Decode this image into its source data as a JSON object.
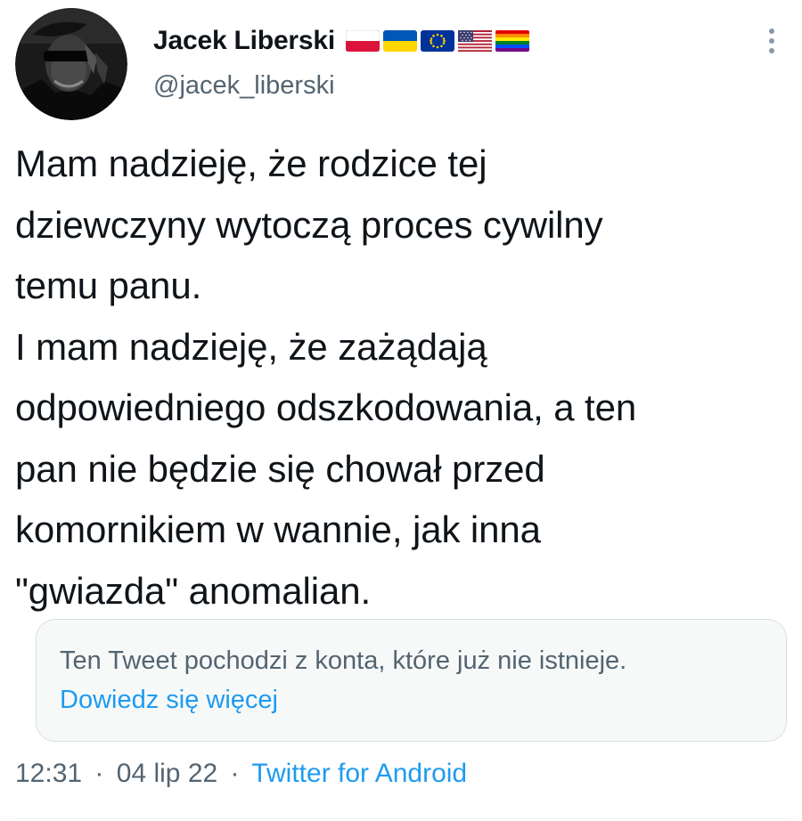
{
  "author": {
    "display_name": "Jacek Liberski",
    "handle": "@jacek_liberski",
    "flags": [
      "poland-flag-icon",
      "ukraine-flag-icon",
      "eu-flag-icon",
      "usa-flag-icon",
      "rainbow-flag-icon"
    ]
  },
  "tweet": {
    "text": "Mam nadzieję, że rodzice tej\ndziewczyny wytoczą proces cywilny\ntemu panu.\nI mam nadzieję, że zażądają\nodpowiedniego odszkodowania, a ten\npan nie będzie się chował przed\nkomornikiem w wannie, jak inna\n\"gwiazda\" anomalian."
  },
  "notice": {
    "text": "Ten Tweet pochodzi z konta, które już nie istnieje.",
    "link_label": "Dowiedz się więcej"
  },
  "meta": {
    "time": "12:31",
    "separator": "·",
    "date": "04 lip 22",
    "source": "Twitter for Android"
  },
  "colors": {
    "text": "#0f1419",
    "secondary": "#536471",
    "link": "#1d9bf0",
    "notice_bg": "#f7f9f9",
    "notice_border": "#d9dee2"
  }
}
